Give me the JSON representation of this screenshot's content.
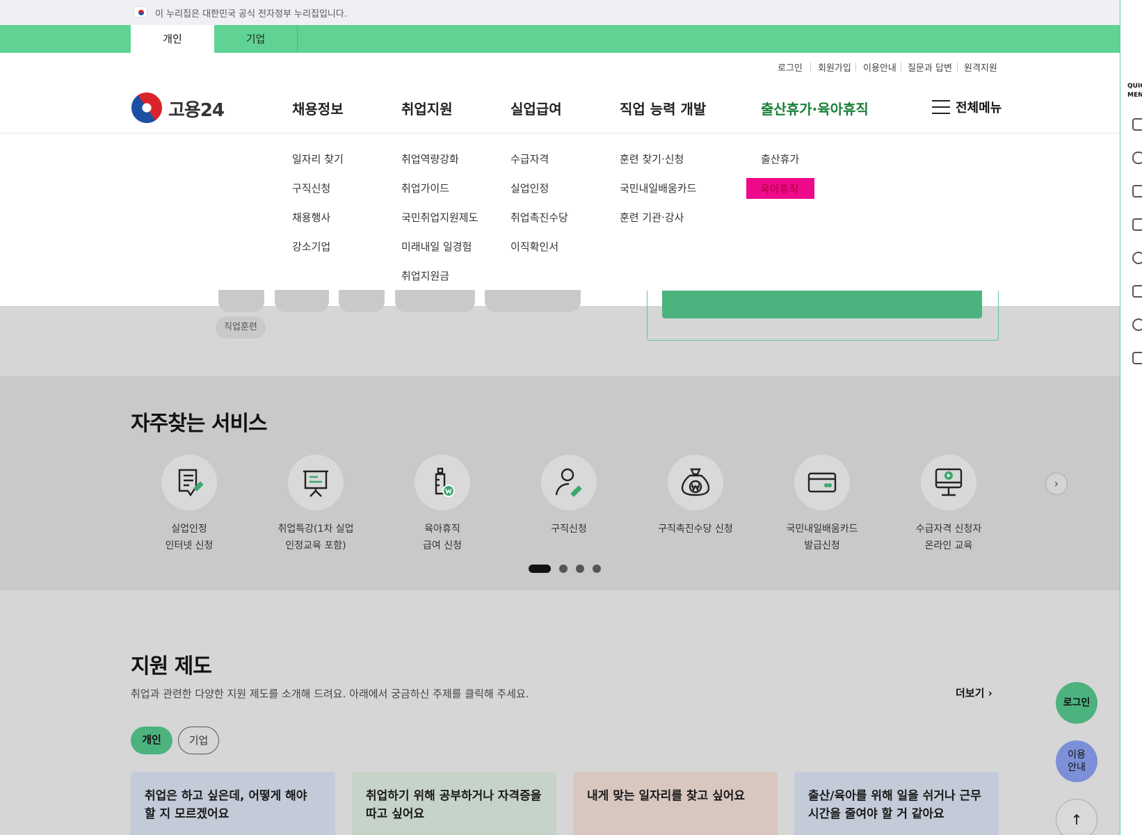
{
  "gov_banner": {
    "text": "이 누리집은 대한민국 공식 전자정부 누리집입니다."
  },
  "tabs": [
    "개인",
    "기업"
  ],
  "util_links": [
    "로그인",
    "회원가입",
    "이용안내",
    "질문과 답변",
    "원격지원"
  ],
  "logo": {
    "text": "고용24"
  },
  "gnb": [
    {
      "label": "채용정보",
      "subs": [
        "일자리 찾기",
        "구직신청",
        "채용행사",
        "강소기업"
      ]
    },
    {
      "label": "취업지원",
      "subs": [
        "취업역량강화",
        "취업가이드",
        "국민취업지원제도",
        "미래내일 일경험",
        "취업지원금"
      ]
    },
    {
      "label": "실업급여",
      "subs": [
        "수급자격",
        "실업인정",
        "취업촉진수당",
        "이직확인서"
      ]
    },
    {
      "label": "직업 능력 개발",
      "subs": [
        "훈련 찾기·신청",
        "국민내일배움카드",
        "훈련 기관·강사"
      ]
    },
    {
      "label": "출산휴가·육아휴직",
      "subs": [
        "출산휴가",
        "육아휴직"
      ]
    }
  ],
  "all_menu": "전체메뉴",
  "chip_visible": "직업훈련",
  "frequent": {
    "title": "자주찾는 서비스",
    "items": [
      {
        "line1": "실업인정",
        "line2": "인터넷 신청",
        "icon": "document-pen-icon"
      },
      {
        "line1": "취업특강(1차 실업",
        "line2": "인정교육 포함)",
        "icon": "presentation-board-icon"
      },
      {
        "line1": "육아휴직",
        "line2": "급여 신청",
        "icon": "baby-bottle-icon"
      },
      {
        "line1": "구직신청",
        "line2": "",
        "icon": "person-pen-icon"
      },
      {
        "line1": "구직촉진수당 신청",
        "line2": "",
        "icon": "money-bag-icon"
      },
      {
        "line1": "국민내일배움카드",
        "line2": "발급신청",
        "icon": "card-icon"
      },
      {
        "line1": "수급자격 신청자",
        "line2": "온라인 교육",
        "icon": "video-monitor-icon"
      }
    ]
  },
  "support": {
    "title": "지원 제도",
    "desc": "취업과 관련한 다양한 지원 제도를 소개해 드려요. 아래에서 궁금하신 주제를 클릭해 주세요.",
    "more": "더보기",
    "pills": [
      "개인",
      "기업"
    ],
    "cards": [
      {
        "text": "취업은 하고 싶은데, 어떻게 해야 할 지 모르겠어요",
        "color": "#c3cbd9"
      },
      {
        "text": "취업하기 위해 공부하거나 자격증을 따고 싶어요",
        "color": "#c6d3c8"
      },
      {
        "text": "내게 맞는 일자리를 찾고 싶어요",
        "color": "#d8c7bf"
      },
      {
        "text": "출산/육아를 위해 일을 쉬거나 근무 시간을 줄여야 할 거 같아요",
        "color": "#c3cbd9"
      }
    ]
  },
  "quick": {
    "label1": "QUIC",
    "label2": "MEN"
  },
  "fab": {
    "login": "로그인",
    "guide1": "이용",
    "guide2": "안내",
    "top": "↑"
  }
}
